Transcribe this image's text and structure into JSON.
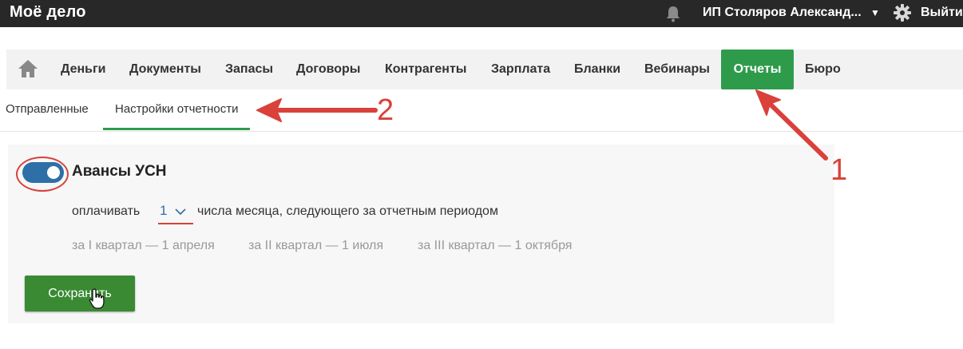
{
  "topbar": {
    "logo": "Моё дело",
    "user_name": "ИП Столяров Александ...",
    "logout_label": "Выйти",
    "icons": [
      "bell-icon",
      "chevron-down-icon",
      "gear-icon"
    ]
  },
  "nav": {
    "items": [
      {
        "label": "Деньги"
      },
      {
        "label": "Документы"
      },
      {
        "label": "Запасы"
      },
      {
        "label": "Договоры"
      },
      {
        "label": "Контрагенты"
      },
      {
        "label": "Зарплата"
      },
      {
        "label": "Бланки"
      },
      {
        "label": "Вебинары"
      },
      {
        "label": "Отчеты",
        "active": true
      },
      {
        "label": "Бюро"
      }
    ],
    "active_color": "#2e9b4b"
  },
  "subtabs": [
    {
      "label": "Отправленные"
    },
    {
      "label": "Настройки отчетности",
      "active": true
    }
  ],
  "settings": {
    "section_title": "Авансы УСН",
    "toggle_on": true,
    "pay_label": "оплачивать",
    "day_value": "1",
    "pay_suffix": "числа месяца, следующего за отчетным периодом",
    "quarters": [
      "за I квартал — 1 апреля",
      "за II квартал — 1 июля",
      "за III квартал — 1 октября"
    ],
    "save_label": "Сохранить"
  },
  "annotations": {
    "label_1": "1",
    "label_2": "2",
    "color": "#d9413a"
  },
  "colors": {
    "topbar": "#282828",
    "accent_green": "#2e9b4b",
    "button_green": "#3a8a34",
    "toggle_blue": "#2e6fa7"
  }
}
